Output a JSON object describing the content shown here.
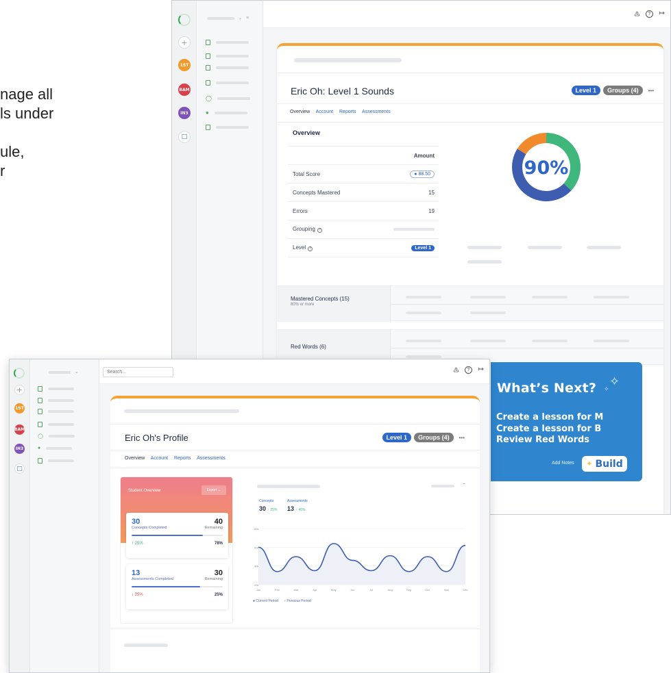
{
  "background_text": [
    "nage all",
    "ls under",
    "",
    "ule,",
    "r"
  ],
  "top_window": {
    "rail_avatars": [
      {
        "label": "1ST",
        "color": "#f09a2c"
      },
      {
        "label": "BAM",
        "color": "#d7414b"
      },
      {
        "label": "IN3",
        "color": "#7e52b8"
      }
    ],
    "student_title": "Eric Oh: Level 1 Sounds",
    "level_badge": "Level 1",
    "groups_badge": "Groups (4)",
    "more_label": "•••",
    "tabs": [
      "Overview",
      "Account",
      "Reports",
      "Assessments"
    ],
    "overview_heading": "Overview",
    "amount_header": "Amount",
    "rows": [
      {
        "label": "Total Score",
        "value": "88.50"
      },
      {
        "label": "Concepts Mastered",
        "value": "15"
      },
      {
        "label": "Errors",
        "value": "19"
      },
      {
        "label": "Grouping",
        "value": ""
      },
      {
        "label": "Level",
        "value": "Level 1"
      }
    ],
    "donut": {
      "label": "90%",
      "segments": [
        {
          "value": 37,
          "color": "#3fb67c"
        },
        {
          "value": 47,
          "color": "#3f5db0"
        },
        {
          "value": 16,
          "color": "#f08a2a"
        }
      ]
    },
    "mastered_title": "Mastered Concepts (15)",
    "mastered_sub": "80% or more",
    "red_words_title": "Red Words (6)"
  },
  "bottom_window": {
    "search_placeholder": "Search...",
    "profile_title": "Eric Oh's Profile",
    "level_badge": "Level 1",
    "groups_badge": "Groups (4)",
    "more_label": "•••",
    "tabs": [
      "Overview",
      "Account",
      "Reports",
      "Assessments"
    ],
    "student_overview_title": "Student Overview",
    "export_label": "Export",
    "concepts_completed": "30",
    "concepts_completed_label": "Concepts Completed",
    "concepts_remaining": "40",
    "remaining_label": "Remaining",
    "concepts_change": "↑ 25%",
    "concepts_progress_label": "78%",
    "concepts_progress": 0.78,
    "assessments_completed": "13",
    "assessments_completed_label": "Assessments Completed",
    "assessments_remaining": "30",
    "assessments_change": "↓ 25%",
    "assessments_progress_label": "25%",
    "assessments_progress": 0.75,
    "concepts_label": "Concepts",
    "concepts_value": "30",
    "concepts_delta": "↑ 25%",
    "assessments_label": "Assessments",
    "assessments_value": "13",
    "assessments_delta": "↑ 46%",
    "legend_current": "Current Period",
    "legend_previous": "Previous Period"
  },
  "chart_data": {
    "type": "line",
    "x": [
      "Jan",
      "Feb",
      "Mar",
      "Apr",
      "May",
      "Jun",
      "Jul",
      "Aug",
      "Sep",
      "Oct",
      "Nov",
      "Dec"
    ],
    "yticks": [
      "80k",
      "60k",
      "40k",
      "20k"
    ],
    "ylim": [
      20,
      80
    ],
    "series": [
      {
        "name": "Current Period",
        "values": [
          60,
          34,
          50,
          35,
          64,
          46,
          35,
          51,
          34,
          50,
          34,
          62
        ],
        "color": "#3f5db0"
      },
      {
        "name": "Previous Period",
        "values": [
          48,
          28,
          42,
          30,
          55,
          40,
          30,
          42,
          30,
          42,
          28,
          54
        ],
        "color": "#c8ccd8"
      }
    ]
  },
  "whats_next": {
    "title": "What’s Next?",
    "items": [
      "Create a lesson for M",
      "Create a lesson for B",
      "Review Red Words"
    ],
    "add_notes": "Add Notes",
    "build_label": "Build"
  }
}
